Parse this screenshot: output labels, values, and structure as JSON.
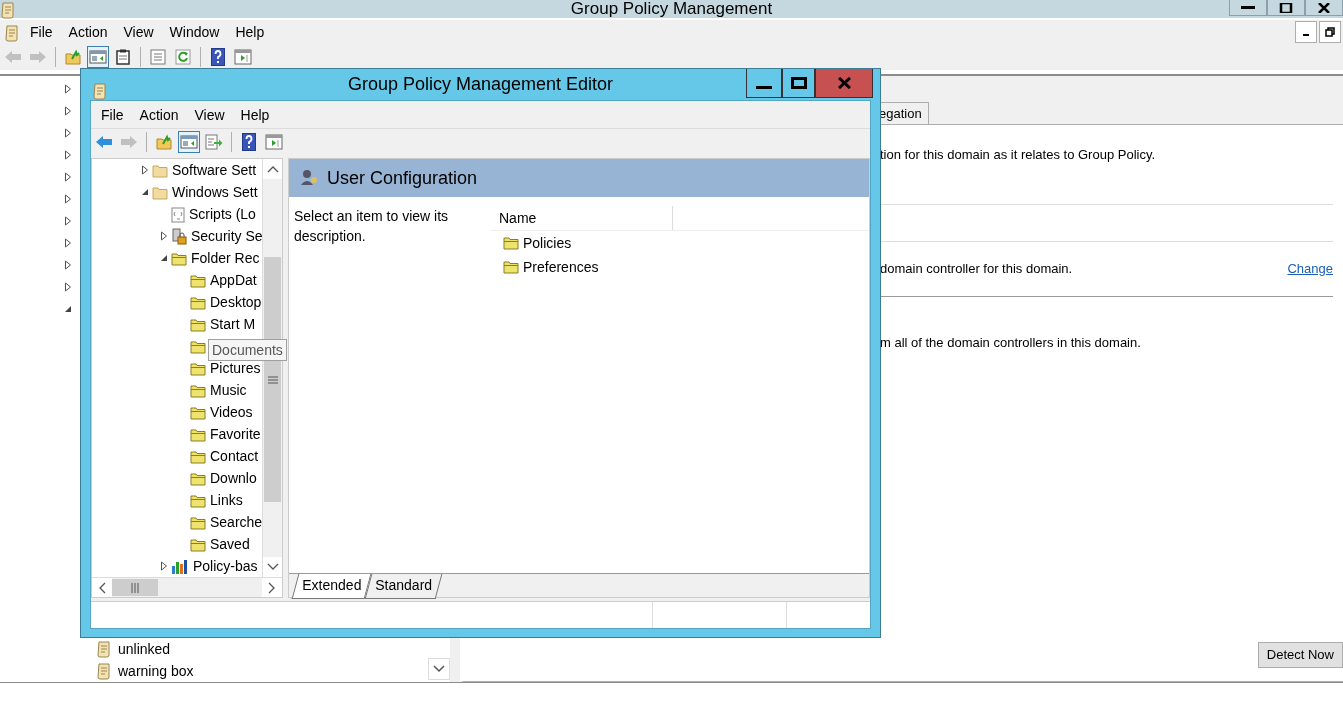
{
  "main_window": {
    "title": "Group Policy Management",
    "menu": [
      "File",
      "Action",
      "View",
      "Window",
      "Help"
    ],
    "toolbar": [
      {
        "kind": "back",
        "disabled": true,
        "pressed": false
      },
      {
        "kind": "forward",
        "disabled": true,
        "pressed": false
      },
      {
        "kind": "separator"
      },
      {
        "kind": "up",
        "disabled": false,
        "pressed": false
      },
      {
        "kind": "tree",
        "disabled": false,
        "pressed": true
      },
      {
        "kind": "clipboard",
        "disabled": false,
        "pressed": false
      },
      {
        "kind": "separator"
      },
      {
        "kind": "properties",
        "disabled": false,
        "pressed": false
      },
      {
        "kind": "refresh",
        "disabled": false,
        "pressed": false
      },
      {
        "kind": "separator"
      },
      {
        "kind": "help",
        "disabled": false,
        "pressed": false
      },
      {
        "kind": "console",
        "disabled": false,
        "pressed": false
      }
    ],
    "tree": {
      "items": [
        {
          "expanded": false
        },
        {
          "expanded": false
        },
        {
          "expanded": false
        },
        {
          "expanded": false
        },
        {
          "expanded": false
        },
        {
          "expanded": false
        },
        {
          "expanded": false
        },
        {
          "expanded": false
        },
        {
          "expanded": false
        },
        {
          "expanded": false
        },
        {
          "expanded": true
        }
      ],
      "leaf_items": [
        {
          "label": "unlinked"
        },
        {
          "label": "warning box"
        }
      ]
    },
    "detail": {
      "tab": "egation",
      "rows": [
        {
          "text": "tion for this domain as it relates to Group Policy."
        },
        {
          "text": "domain controller for this domain.",
          "link": "Change"
        },
        {
          "text": "m all of the domain controllers in this domain."
        }
      ],
      "button": "Detect Now"
    }
  },
  "editor_window": {
    "title": "Group Policy Management Editor",
    "menu": [
      "File",
      "Action",
      "View",
      "Help"
    ],
    "toolbar": [
      {
        "kind": "back",
        "disabled": false,
        "pressed": false
      },
      {
        "kind": "forward",
        "disabled": true,
        "pressed": false
      },
      {
        "kind": "separator"
      },
      {
        "kind": "up",
        "disabled": false,
        "pressed": false
      },
      {
        "kind": "tree",
        "disabled": false,
        "pressed": true
      },
      {
        "kind": "export",
        "disabled": false,
        "pressed": false
      },
      {
        "kind": "separator"
      },
      {
        "kind": "help",
        "disabled": false,
        "pressed": false
      },
      {
        "kind": "console",
        "disabled": false,
        "pressed": false
      }
    ],
    "tree": [
      {
        "label": "Software Sett",
        "kind": "folder",
        "expanded": false
      },
      {
        "label": "Windows Sett",
        "kind": "folder",
        "expanded": true,
        "children": [
          {
            "label": "Scripts (Lo",
            "kind": "script"
          },
          {
            "label": "Security Se",
            "kind": "security",
            "expanded": false
          },
          {
            "label": "Folder Rec",
            "kind": "folder-yellow",
            "expanded": true,
            "children": [
              {
                "label": "AppDat",
                "kind": "folder-yellow"
              },
              {
                "label": "Desktop",
                "kind": "folder-yellow"
              },
              {
                "label": "Start M",
                "kind": "folder-yellow"
              },
              {
                "kind": "folder-yellow",
                "tooltip": "Documents"
              },
              {
                "label": "Pictures",
                "kind": "folder-yellow"
              },
              {
                "label": "Music",
                "kind": "folder-yellow"
              },
              {
                "label": "Videos",
                "kind": "folder-yellow"
              },
              {
                "label": "Favorite",
                "kind": "folder-yellow"
              },
              {
                "label": "Contact",
                "kind": "folder-yellow"
              },
              {
                "label": "Downlo",
                "kind": "folder-yellow"
              },
              {
                "label": "Links",
                "kind": "folder-yellow"
              },
              {
                "label": "Searche",
                "kind": "folder-yellow"
              },
              {
                "label": "Saved",
                "kind": "folder-yellow"
              }
            ]
          },
          {
            "label": "Policy-bas",
            "kind": "chart",
            "expanded": false
          }
        ]
      }
    ],
    "header": "User Configuration",
    "description": "Select an item to view its description.",
    "list": {
      "column": "Name",
      "items": [
        {
          "label": "Policies"
        },
        {
          "label": "Preferences"
        }
      ]
    },
    "tabs": [
      {
        "label": "Extended",
        "selected": true
      },
      {
        "label": "Standard",
        "selected": false
      }
    ]
  }
}
